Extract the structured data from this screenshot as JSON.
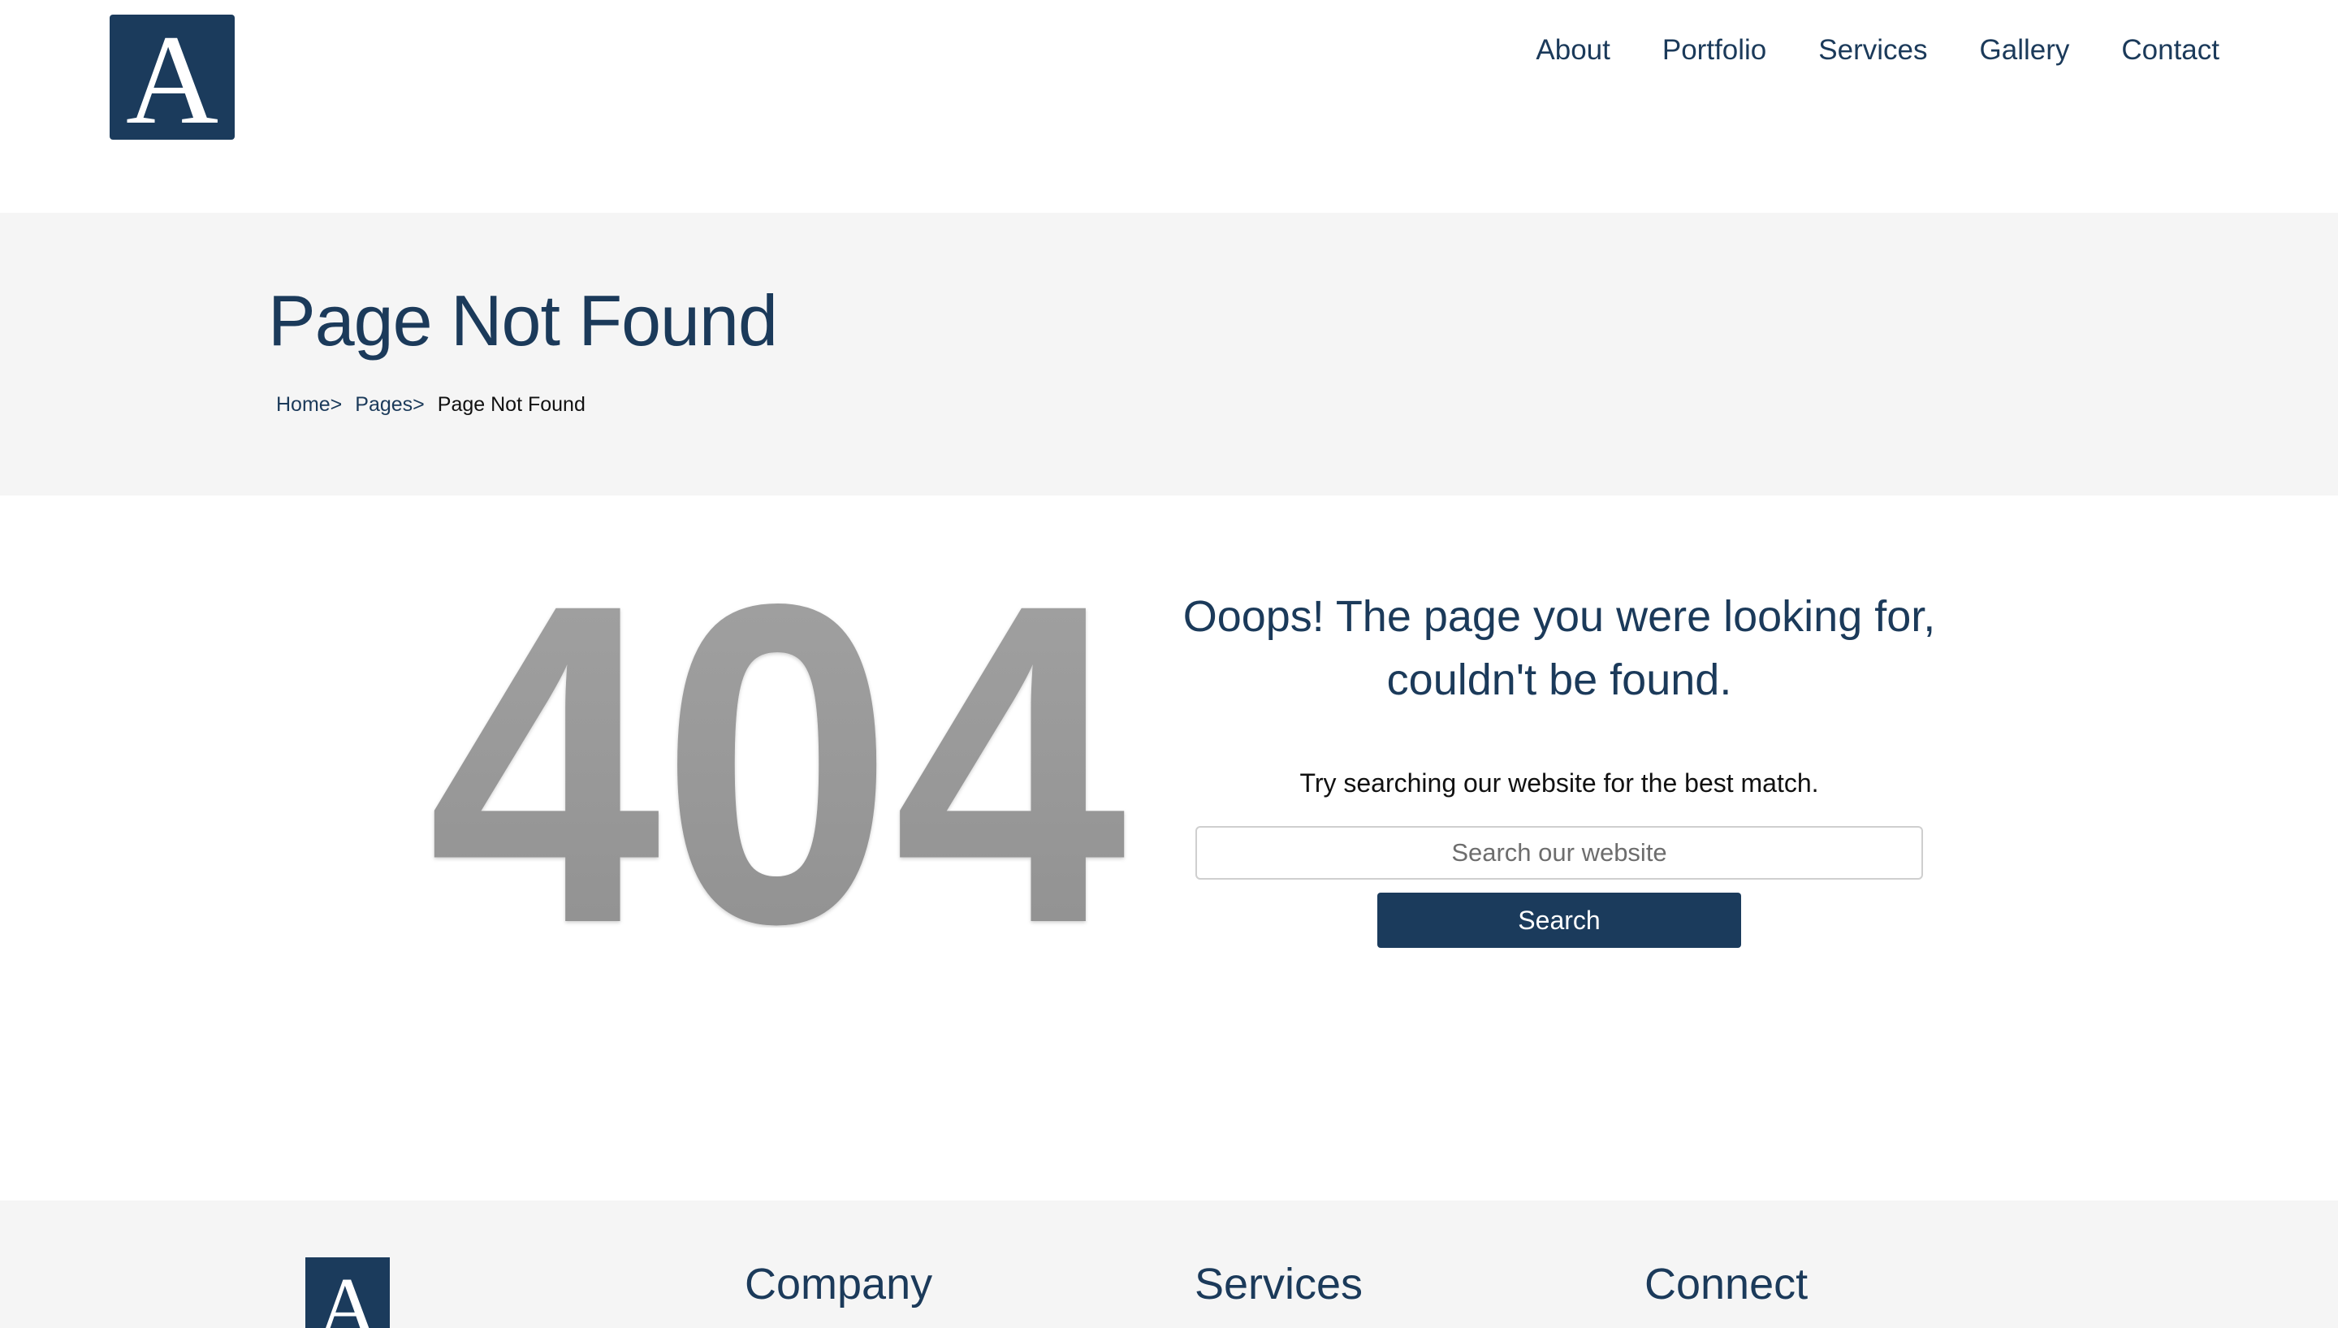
{
  "header": {
    "logo_letter": "A",
    "nav": [
      "About",
      "Portfolio",
      "Services",
      "Gallery",
      "Contact"
    ]
  },
  "title_band": {
    "title": "Page Not Found",
    "breadcrumb": [
      "Home>",
      "Pages>",
      "Page Not Found"
    ]
  },
  "main": {
    "error_code": "404",
    "heading_line1": "Ooops! The page you were looking for,",
    "heading_line2": "couldn't be found.",
    "hint": "Try searching our website for the best match.",
    "search_placeholder": "Search our website",
    "search_button": "Search"
  },
  "footer": {
    "logo_letter": "A",
    "columns": [
      "Company",
      "Services",
      "Connect"
    ]
  },
  "colors": {
    "brand": "#1b3b5c",
    "band_background": "#f5f5f5",
    "error_code": "#959595"
  }
}
